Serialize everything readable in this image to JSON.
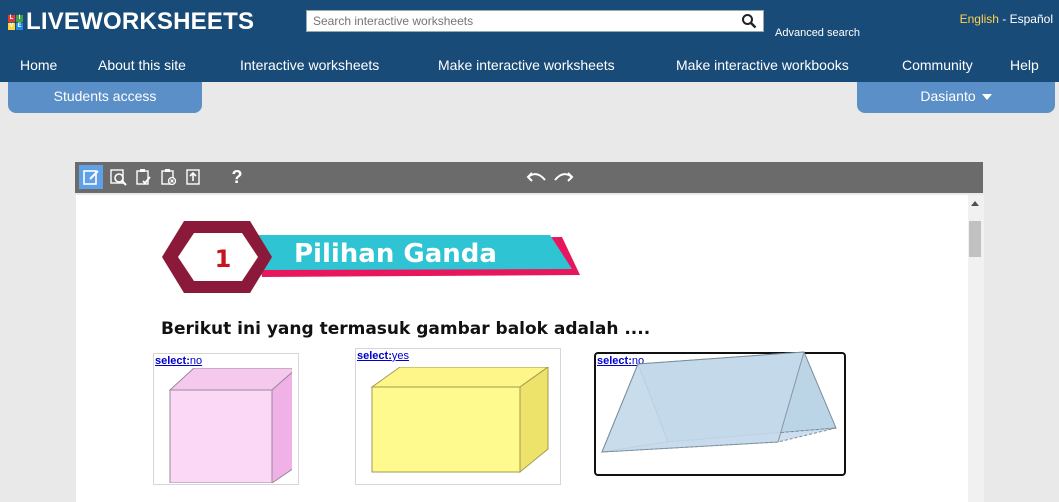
{
  "header": {
    "logo_text": "LIVEWORKSHEETS",
    "logo_letters": [
      "L",
      "I",
      "V",
      "E"
    ],
    "search_placeholder": "Search interactive worksheets",
    "advanced_search": "Advanced search",
    "lang_en": "English",
    "lang_sep": " - ",
    "lang_es": "Español"
  },
  "nav": {
    "items": [
      "Home",
      "About this site",
      "Interactive worksheets",
      "Make interactive worksheets",
      "Make interactive workbooks",
      "Community",
      "Help"
    ]
  },
  "tabs": {
    "students": "Students access",
    "user": "Dasianto"
  },
  "toolbar": {
    "help": "?"
  },
  "worksheet": {
    "number": "1",
    "title": "Pilihan Ganda",
    "question": "Berikut ini yang termasuk gambar balok adalah ....",
    "options": [
      {
        "prefix": "select:",
        "value": "no",
        "shape": "cube"
      },
      {
        "prefix": "select:",
        "value": "yes",
        "shape": "cuboid"
      },
      {
        "prefix": "select:",
        "value": "no",
        "shape": "prism"
      }
    ]
  },
  "colors": {
    "header_bg": "#194b78",
    "tab_bg": "#5b8fc7",
    "toolbar_bg": "#6b6b6b",
    "active_tool": "#5fa0e8",
    "banner_pink": "#e8175d",
    "banner_teal": "#2fc4d4",
    "hexagon": "#8b1a3a"
  }
}
